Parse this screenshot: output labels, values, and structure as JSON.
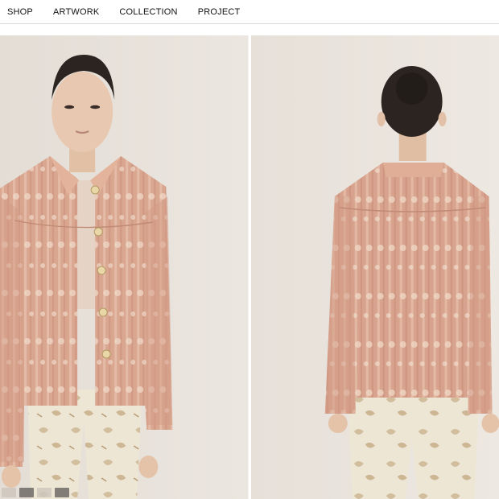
{
  "nav": {
    "items": [
      {
        "label": "SHOP"
      },
      {
        "label": "ARTWORK"
      },
      {
        "label": "COLLECTION"
      },
      {
        "label": "PROJECT"
      }
    ]
  },
  "gallery": {
    "images": [
      {
        "name": "front-view"
      },
      {
        "name": "back-view"
      }
    ],
    "thumbnail_count": 4
  },
  "colors": {
    "background": "#e8e2da",
    "jacket": "#d9a48e",
    "pants": "#ece6d6",
    "hair": "#2a2420",
    "skin": "#e6c5ad"
  }
}
